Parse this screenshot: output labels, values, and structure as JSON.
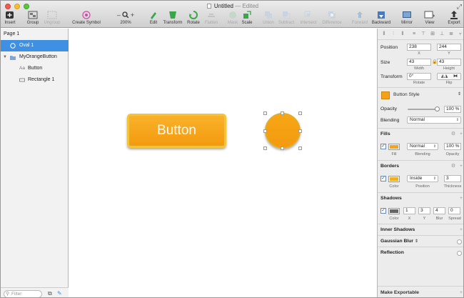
{
  "window": {
    "title": "Untitled",
    "title_suffix": "— Edited"
  },
  "toolbar": {
    "insert": "Insert",
    "group": "Group",
    "ungroup": "Ungroup",
    "create_symbol": "Create Symbol",
    "zoom": "200%",
    "edit": "Edit",
    "transform": "Transform",
    "rotate": "Rotate",
    "flatten": "Flatten",
    "mask": "Mask",
    "scale": "Scale",
    "union": "Union",
    "subtract": "Subtract",
    "intersect": "Intersect",
    "difference": "Difference",
    "forward": "Forward",
    "backward": "Backward",
    "mirror": "Mirror",
    "view": "View",
    "export": "Export"
  },
  "layers": {
    "page": "Page 1",
    "items": [
      {
        "label": "Oval 1",
        "icon": "oval-icon",
        "selected": true
      },
      {
        "label": "MyOrangeButton",
        "icon": "folder-icon"
      },
      {
        "label": "Button",
        "icon": "text-icon"
      },
      {
        "label": "Rectangle 1",
        "icon": "rectangle-icon"
      }
    ],
    "filter_placeholder": "Filter"
  },
  "canvas": {
    "button_text": "Button",
    "colors": {
      "orange": "#f5a21a",
      "border": "#f4c33c"
    }
  },
  "inspector": {
    "position_label": "Position",
    "position_x": "238",
    "position_y": "244",
    "x_label": "X",
    "y_label": "Y",
    "size_label": "Size",
    "width": "43",
    "height": "43",
    "width_label": "Width",
    "height_label": "Height",
    "transform_label": "Transform",
    "rotate": "0°",
    "rotate_label": "Rotate",
    "flip_label": "Flip",
    "style_name": "Button Style",
    "opacity_label": "Opacity",
    "opacity_value": "100 %",
    "blending_label": "Blending",
    "blending_value": "Normal",
    "fills": {
      "title": "Fills",
      "blend": "Normal",
      "opacity": "100 %",
      "fill_label": "Fill",
      "blending_label": "Blending",
      "opacity_label": "Opacity",
      "color": "#f5a21a"
    },
    "borders": {
      "title": "Borders",
      "position": "Inside",
      "thickness": "3",
      "color_label": "Color",
      "position_label": "Position",
      "thickness_label": "Thickness",
      "color": "#f2b01e"
    },
    "shadows": {
      "title": "Shadows",
      "x": "1",
      "y": "3",
      "blur": "4",
      "spread": "0",
      "color_label": "Color",
      "x_label": "X",
      "y_label": "Y",
      "blur_label": "Blur",
      "spread_label": "Spread",
      "color": "#666666"
    },
    "inner_shadows": "Inner Shadows",
    "gaussian_blur": "Gaussian Blur",
    "reflection": "Reflection",
    "make_exportable": "Make Exportable"
  }
}
